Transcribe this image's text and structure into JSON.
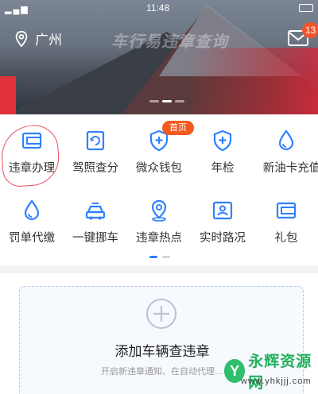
{
  "status_bar": {
    "time": "11:48"
  },
  "header": {
    "city": "广州",
    "banner_text": "车行易违章查询",
    "mail_badge": "13"
  },
  "grid": {
    "row1": [
      {
        "label": "违章办理",
        "icon": "wallet-card-icon"
      },
      {
        "label": "驾照查分",
        "icon": "license-refresh-icon"
      },
      {
        "label": "微众钱包",
        "icon": "shield-plus-icon",
        "badge": "首页"
      },
      {
        "label": "年检",
        "icon": "shield-plus-icon"
      },
      {
        "label": "新油卡充值",
        "icon": "drop-icon"
      }
    ],
    "row2": [
      {
        "label": "罚单代缴",
        "icon": "drop-icon"
      },
      {
        "label": "一键挪车",
        "icon": "car-icon"
      },
      {
        "label": "违章热点",
        "icon": "location-pin-icon"
      },
      {
        "label": "实时路况",
        "icon": "portrait-card-icon"
      },
      {
        "label": "礼包",
        "icon": "wallet-card-icon"
      }
    ]
  },
  "add_vehicle": {
    "title": "添加车辆查违章",
    "subtitle": "开启新违章通知、在自动代理…"
  },
  "watermark": {
    "name": "永辉资源网",
    "url": "www.yhkjjj.com"
  },
  "colors": {
    "accent": "#2f80ff",
    "badge": "#f35a1f",
    "mail_badge": "#f2532d"
  }
}
